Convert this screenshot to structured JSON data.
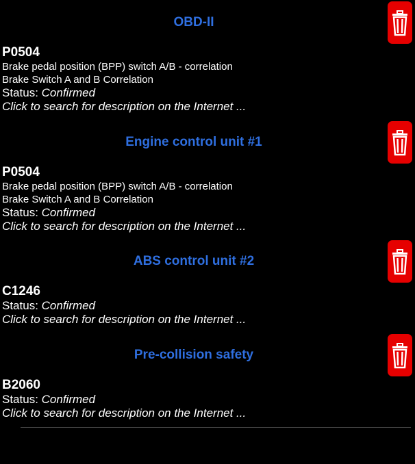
{
  "sections": [
    {
      "title": "OBD-II",
      "code": "P0504",
      "lines": [
        "Brake pedal position (BPP) switch A/B - correlation",
        "Brake Switch A and B Correlation"
      ],
      "status_label": "Status: ",
      "status_value": "Confirmed",
      "search_text": "Click to search for description on the Internet ..."
    },
    {
      "title": "Engine control unit #1",
      "code": "P0504",
      "lines": [
        "Brake pedal position (BPP) switch A/B - correlation",
        "Brake Switch A and B Correlation"
      ],
      "status_label": "Status: ",
      "status_value": "Confirmed",
      "search_text": "Click to search for description on the Internet ..."
    },
    {
      "title": "ABS control unit #2",
      "code": "C1246",
      "lines": [],
      "status_label": "Status: ",
      "status_value": "Confirmed",
      "search_text": "Click to search for description on the Internet ..."
    },
    {
      "title": "Pre-collision safety",
      "code": "B2060",
      "lines": [],
      "status_label": "Status: ",
      "status_value": "Confirmed",
      "search_text": "Click to search for description on the Internet ..."
    }
  ],
  "icons": {
    "delete": "trash-icon"
  },
  "colors": {
    "background": "#000000",
    "section_title": "#2f6fe0",
    "delete_button": "#e60000",
    "text": "#ffffff"
  }
}
